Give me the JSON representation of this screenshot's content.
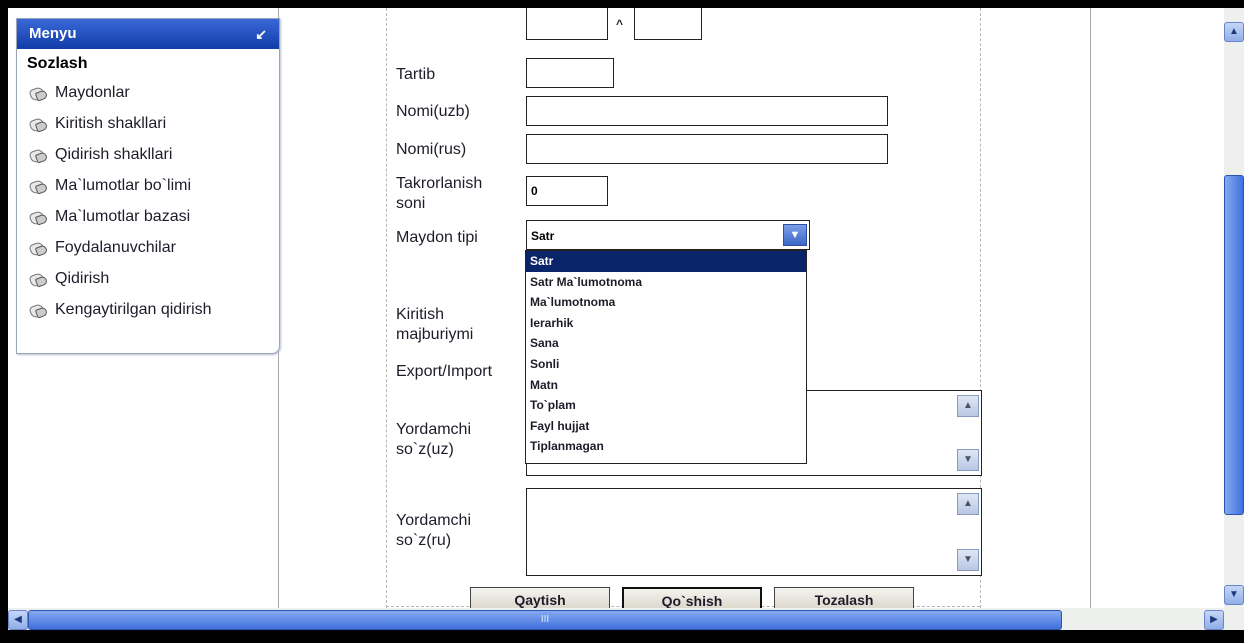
{
  "sidebar": {
    "header": "Menyu",
    "collapse_glyph": "↙",
    "section_title": "Sozlash",
    "items": [
      {
        "label": "Maydonlar"
      },
      {
        "label": "Kiritish shakllari"
      },
      {
        "label": "Qidirish shakllari"
      },
      {
        "label": "Ma`lumotlar bo`limi"
      },
      {
        "label": "Ma`lumotlar bazasi"
      },
      {
        "label": "Foydalanuvchilar"
      },
      {
        "label": "Qidirish"
      },
      {
        "label": "Kengaytirilgan qidirish"
      }
    ]
  },
  "form": {
    "caret": "^",
    "tartib_label": "Tartib",
    "tartib_value": "",
    "nomi_uzb_label": "Nomi(uzb)",
    "nomi_uzb_value": "",
    "nomi_rus_label": "Nomi(rus)",
    "nomi_rus_value": "",
    "takror_label_1": "Takrorlanish",
    "takror_label_2": "soni",
    "takror_value": "0",
    "maydon_tipi_label": "Maydon tipi",
    "maydon_tipi_value": "Satr",
    "maydon_tipi_options": [
      "Satr",
      "Satr Ma`lumotnoma",
      "Ma`lumotnoma",
      "Ierarhik",
      "Sana",
      "Sonli",
      "Matn",
      "To`plam",
      "Fayl hujjat",
      "Tiplanmagan"
    ],
    "kiritish_label_1": "Kiritish",
    "kiritish_label_2": "majburiymi",
    "export_label": "Export/Import",
    "yordam_uz_label_1": "Yordamchi",
    "yordam_uz_label_2": "so`z(uz)",
    "yordam_ru_label_1": "Yordamchi",
    "yordam_ru_label_2": "so`z(ru)"
  },
  "buttons": {
    "back": "Qaytish",
    "add": "Qo`shish",
    "clear": "Tozalash"
  },
  "scroll": {
    "up": "▲",
    "down": "▼",
    "left": "◀",
    "right": "▶",
    "grip": "III"
  }
}
